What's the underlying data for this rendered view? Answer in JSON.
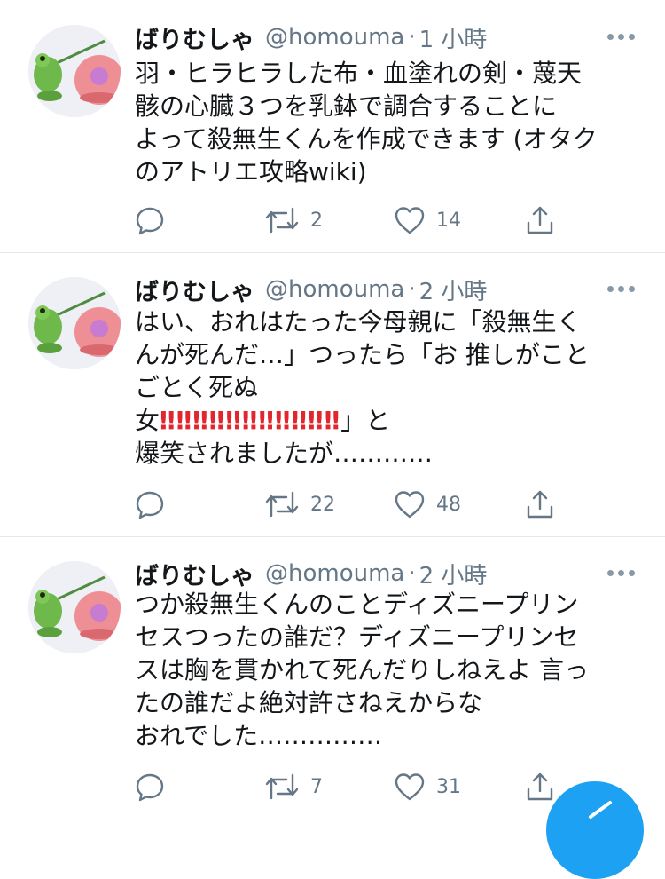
{
  "tweets": [
    {
      "name": "ばりむしゃ",
      "handle": "@homouma",
      "separator": "·",
      "time": "1 小時",
      "lines": [
        "羽・ヒラヒラした布・血塗れの剣・蔑天",
        "骸の心臓３つを乳鉢で調合することに",
        "よって殺無生くんを作成できます (オタク",
        "のアトリエ攻略wiki)"
      ],
      "retweets": "2",
      "likes": "14"
    },
    {
      "name": "ばりむしゃ",
      "handle": "@homouma",
      "separator": "·",
      "time": "2 小時",
      "lines": [
        "はい、おれはたった今母親に「殺無生く",
        "んが死んだ…」つったら「お 推しがこと",
        "ごとく死ぬ"
      ],
      "line4_prefix": "女",
      "line4_bangs": "‼‼‼‼‼‼‼‼‼‼‼",
      "line4_suffix": "」と",
      "line5": "爆笑されましたが…………",
      "retweets": "22",
      "likes": "48"
    },
    {
      "name": "ばりむしゃ",
      "handle": "@homouma",
      "separator": "·",
      "time": "2 小時",
      "lines": [
        "つか殺無生くんのことディズニープリン",
        "セスつったの誰だ？ディズニープリンセ",
        "スは胸を貫かれて死んだりしねえよ 言っ",
        "たの誰だよ絶対許さねえからな",
        "おれでした……………"
      ],
      "retweets": "7",
      "likes": "31"
    }
  ],
  "colors": {
    "accent": "#1da1f2",
    "secondary_text": "#657786",
    "border": "#e1e8ed",
    "emoji_red": "#e1262d"
  },
  "icons": [
    "avatar-frog",
    "more-dots-icon",
    "reply-icon",
    "retweet-icon",
    "like-icon",
    "share-icon",
    "compose-tweet-icon"
  ]
}
